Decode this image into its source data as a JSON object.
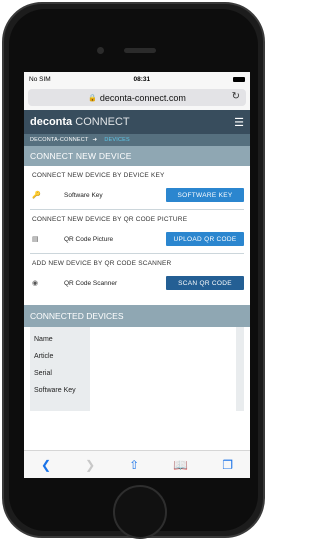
{
  "status": {
    "carrier": "No SIM",
    "time": "08:31"
  },
  "browser": {
    "url": "deconta-connect.com"
  },
  "app": {
    "brand_bold": "deconta",
    "brand_light": "CONNECT"
  },
  "breadcrumb": {
    "home": "DECONTA-CONNECT",
    "current": "DEVICES"
  },
  "connect": {
    "title": "CONNECT NEW DEVICE",
    "groups": [
      {
        "title": "CONNECT NEW DEVICE BY DEVICE KEY",
        "label": "Software Key",
        "button": "SOFTWARE KEY"
      },
      {
        "title": "CONNECT NEW DEVICE BY QR CODE PICTURE",
        "label": "QR Code Picture",
        "button": "UPLOAD QR CODE"
      },
      {
        "title": "ADD NEW DEVICE BY QR CODE SCANNER",
        "label": "QR Code Scanner",
        "button": "SCAN QR CODE"
      }
    ]
  },
  "connected": {
    "title": "CONNECTED DEVICES",
    "fields": [
      "Name",
      "Article",
      "Serial",
      "Software Key"
    ]
  },
  "icons": {
    "key": "key-icon",
    "picture": "picture-icon",
    "camera": "camera-icon"
  },
  "colors": {
    "appbar": "#384d5d",
    "section": "#8fa7b3",
    "button": "#2b86cf",
    "link": "#5ec8ea"
  }
}
